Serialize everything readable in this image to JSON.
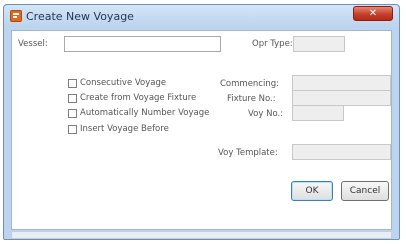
{
  "window": {
    "title": "Create New Voyage",
    "close_glyph": "✕"
  },
  "form": {
    "vessel_label": "Vessel:",
    "vessel_value": "",
    "opr_type_label": "Opr Type:",
    "opr_type_value": "",
    "checkboxes": [
      {
        "label": "Consecutive Voyage",
        "checked": false
      },
      {
        "label": "Create from Voyage Fixture",
        "checked": false
      },
      {
        "label": "Automatically Number Voyage",
        "checked": false
      },
      {
        "label": "Insert Voyage Before",
        "checked": false
      }
    ],
    "commencing_label": "Commencing:",
    "commencing_value": "",
    "fixture_no_label": "Fixture No.:",
    "fixture_no_value": "",
    "voy_no_label": "Voy No.:",
    "voy_no_value": "",
    "voy_template_label": "Voy Template:",
    "voy_template_value": ""
  },
  "buttons": {
    "ok": "OK",
    "cancel": "Cancel"
  },
  "icons": {
    "app": "voyage-app-icon",
    "close": "close-icon"
  }
}
